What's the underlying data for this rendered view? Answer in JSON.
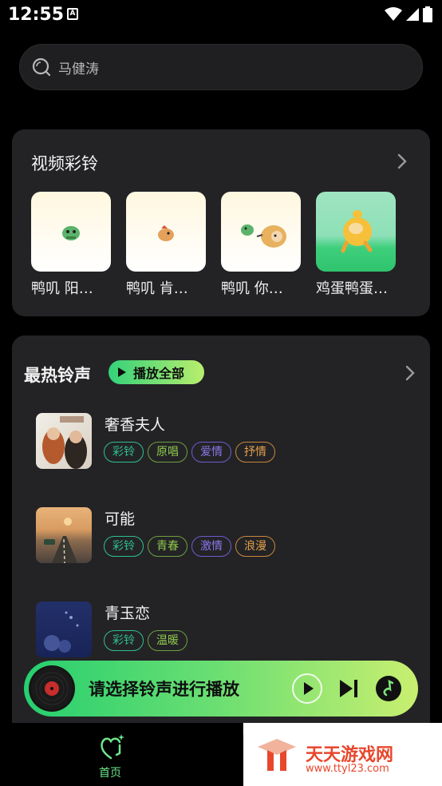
{
  "status": {
    "time": "12:55",
    "notif_glyph": "A"
  },
  "search": {
    "placeholder": "马健涛"
  },
  "video_section": {
    "title": "视频彩铃",
    "items": [
      {
        "caption": "鸭叽 阳…"
      },
      {
        "caption": "鸭叽 肯…"
      },
      {
        "caption": "鸭叽 你…"
      },
      {
        "caption": "鸡蛋鸭蛋…"
      }
    ]
  },
  "hot_section": {
    "title": "最热铃声",
    "play_all_label": "播放全部",
    "songs": [
      {
        "title": "奢香夫人",
        "tags": [
          "彩铃",
          "原唱",
          "爱情",
          "抒情"
        ]
      },
      {
        "title": "可能",
        "tags": [
          "彩铃",
          "青春",
          "激情",
          "浪漫"
        ]
      },
      {
        "title": "青玉恋",
        "tags": [
          "彩铃",
          "温暖"
        ]
      }
    ]
  },
  "player": {
    "prompt": "请选择铃声进行播放"
  },
  "nav": {
    "home_label": "首页"
  },
  "watermark": {
    "title": "天天游戏网",
    "url": "www.ttyl23.com"
  },
  "colors": {
    "accent_green": "#34d17a",
    "card_bg": "#232326",
    "tag_green": "#2fbf8f",
    "tag_purple": "#8c78ee",
    "tag_orange": "#e3a04a"
  }
}
